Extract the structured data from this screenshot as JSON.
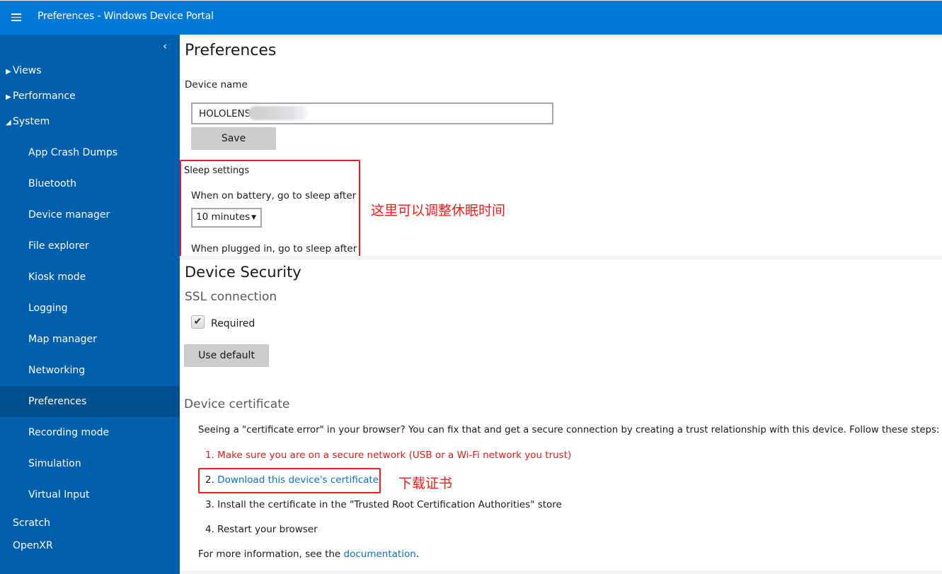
{
  "header": {
    "title": "Preferences - Windows Device Portal",
    "menu_icon": "hamburger-icon"
  },
  "sidebar": {
    "collapse_icon": "chevron-left-icon",
    "groups": [
      {
        "label": "Views",
        "expanded": false,
        "caret": "▶"
      },
      {
        "label": "Performance",
        "expanded": false,
        "caret": "▶"
      },
      {
        "label": "System",
        "expanded": true,
        "caret": "◢"
      }
    ],
    "system_items": [
      {
        "label": "App Crash Dumps"
      },
      {
        "label": "Bluetooth"
      },
      {
        "label": "Device manager"
      },
      {
        "label": "File explorer"
      },
      {
        "label": "Kiosk mode"
      },
      {
        "label": "Logging"
      },
      {
        "label": "Map manager"
      },
      {
        "label": "Networking"
      },
      {
        "label": "Preferences",
        "active": true
      },
      {
        "label": "Recording mode"
      },
      {
        "label": "Simulation"
      },
      {
        "label": "Virtual Input"
      }
    ],
    "top_items": [
      {
        "label": "Scratch"
      },
      {
        "label": "OpenXR"
      }
    ]
  },
  "preferences": {
    "title": "Preferences",
    "device_name_label": "Device name",
    "device_name_value": "HOLOLENS",
    "save_label": "Save",
    "sleep": {
      "heading": "Sleep settings",
      "battery_label": "When on battery, go to sleep after",
      "battery_value": "10 minutes",
      "plugged_label": "When plugged in, go to sleep after"
    }
  },
  "security": {
    "title": "Device Security",
    "ssl_heading": "SSL connection",
    "required_label": "Required",
    "required_checked": true,
    "use_default_label": "Use default",
    "cert_heading": "Device certificate",
    "cert_intro": "Seeing a \"certificate error\" in your browser? You can fix that and get a secure connection by creating a trust relationship with this device. Follow these steps:",
    "steps": [
      {
        "text": "1. Make sure you are on a secure network (USB or a Wi-Fi network you trust)"
      },
      {
        "prefix": "2. ",
        "link": "Download this device's certificate"
      },
      {
        "text": "3. Install the certificate in the \"Trusted Root Certification Authorities\" store"
      },
      {
        "text": "4. Restart your browser"
      }
    ],
    "more_info_prefix": "For more information, see the ",
    "more_info_link": "documentation",
    "more_info_suffix": "."
  },
  "annotations": {
    "sleep_note": "这里可以调整休眠时间",
    "cert_note": "下载证书",
    "color": "#ee1c1c"
  },
  "colors": {
    "topbar": "#0078d7",
    "sidebar": "#005fad",
    "sidebar_active": "#00508f",
    "link": "#0b6fc7",
    "warning": "#e31b1b"
  }
}
